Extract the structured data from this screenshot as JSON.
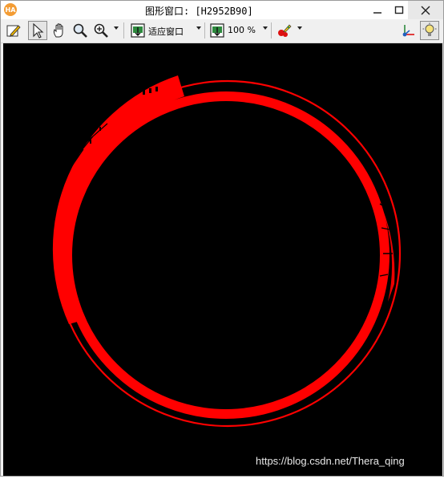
{
  "window": {
    "title": "图形窗口: [H2952B90]",
    "app_icon_text": "HA",
    "controls": {
      "minimize": "—",
      "maximize": "☐",
      "close": "✕"
    }
  },
  "toolbar": {
    "fit_label": "适应窗口",
    "zoom_label": "100 %"
  },
  "canvas": {
    "background": "#000000",
    "region_color": "#ff0000"
  },
  "watermark": "https://blog.csdn.net/Thera_qing"
}
